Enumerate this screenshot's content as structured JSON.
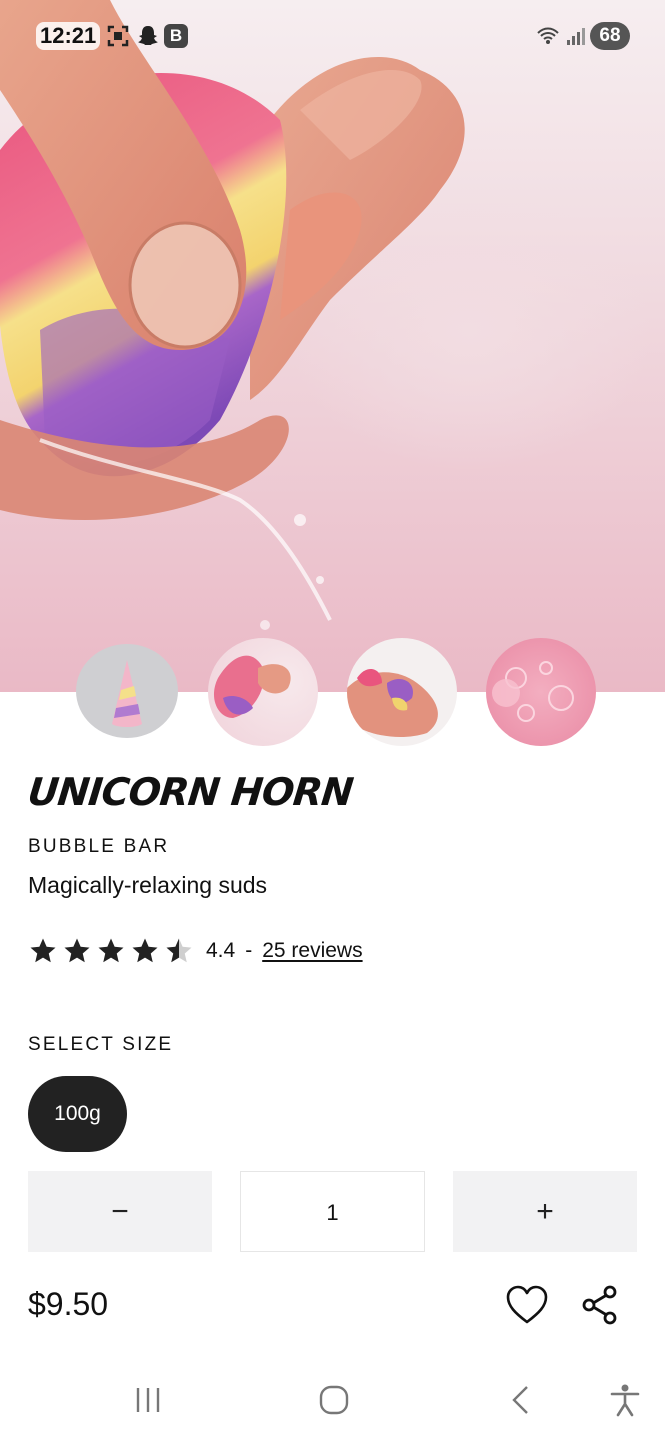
{
  "status_bar": {
    "time": "12:21",
    "battery": "68",
    "icons": [
      "screenshot-icon",
      "snapchat-icon",
      "b-app-icon",
      "wifi-icon",
      "signal-icon",
      "battery-icon"
    ],
    "b_badge": "B"
  },
  "hero": {
    "image": "hand holding pink, yellow and purple bubble bar cone under water"
  },
  "thumbnails": [
    {
      "image": "unicorn horn cone product shot"
    },
    {
      "image": "hand squeezing bubble bar"
    },
    {
      "image": "two hands holding bubble bar"
    },
    {
      "image": "pink bubbles close-up"
    }
  ],
  "product": {
    "name": "UNICORN HORN",
    "category": "BUBBLE BAR",
    "tagline": "Magically-relaxing suds",
    "rating_value": "4.4",
    "rating_fraction": 0.88,
    "rating_separator": "-",
    "reviews_label": "25 reviews"
  },
  "size": {
    "label": "SELECT SIZE",
    "options": [
      "100g"
    ],
    "selected": "100g"
  },
  "quantity": {
    "minus": "−",
    "value": "1",
    "plus": "+"
  },
  "price": "$9.50",
  "actions": [
    "heart-icon",
    "share-icon"
  ],
  "nav": [
    "recent-apps-icon",
    "home-icon",
    "back-icon",
    "accessibility-icon"
  ]
}
